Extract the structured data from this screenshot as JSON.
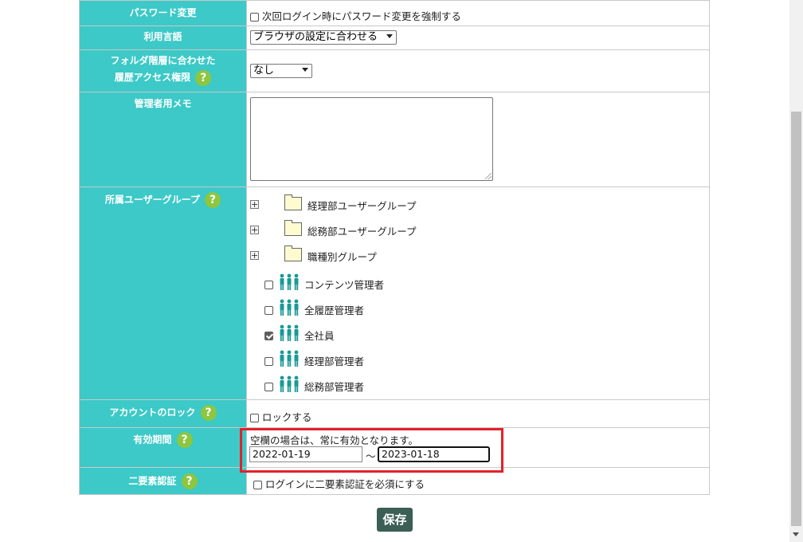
{
  "rows": {
    "password": {
      "label": "パスワード変更",
      "checkbox_label": "次回ログイン時にパスワード変更を強制する",
      "checked": false
    },
    "language": {
      "label": "利用言語",
      "selected": "ブラウザの設定に合わせる"
    },
    "folder_history": {
      "label_line1": "フォルダ階層に合わせた",
      "label_line2": "履歴アクセス権限",
      "selected": "なし"
    },
    "memo": {
      "label": "管理者用メモ",
      "value": ""
    },
    "groups": {
      "label": "所属ユーザーグループ",
      "folders": [
        "経理部ユーザーグループ",
        "総務部ユーザーグループ",
        "職種別グループ"
      ],
      "items": [
        {
          "label": "コンテンツ管理者",
          "checked": false
        },
        {
          "label": "全履歴管理者",
          "checked": false
        },
        {
          "label": "全社員",
          "checked": true
        },
        {
          "label": "経理部管理者",
          "checked": false
        },
        {
          "label": "総務部管理者",
          "checked": false
        }
      ]
    },
    "lock": {
      "label": "アカウントのロック",
      "checkbox_label": "ロックする",
      "checked": false
    },
    "validity": {
      "label": "有効期間",
      "note": "空欄の場合は、常に有効となります。",
      "start": "2022-01-19",
      "separator": "～",
      "end": "2023-01-18"
    },
    "mfa": {
      "label": "二要素認証",
      "checkbox_label": "ログインに二要素認証を必須にする",
      "checked": false
    }
  },
  "help_icon_glyph": "?",
  "tree_expand_glyph": "+",
  "save_label": "保存",
  "colors": {
    "label_bg": "#3cc9c7",
    "help_icon": "#8dc63f",
    "save_button": "#3b5f55",
    "highlight_box": "#e3212b",
    "people_icon": "#1a9a96"
  }
}
